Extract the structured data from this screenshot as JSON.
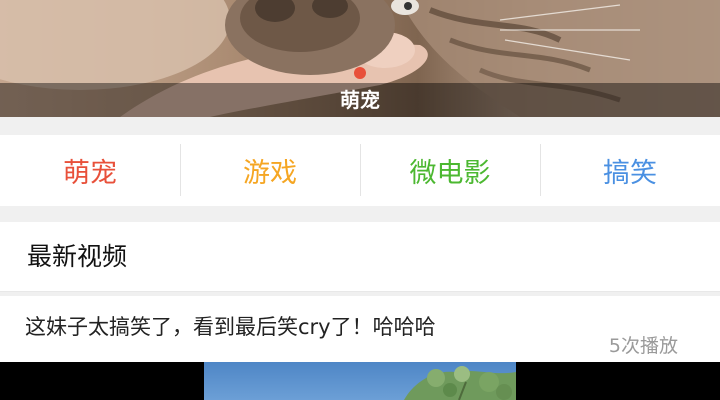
{
  "banner": {
    "caption": "萌宠",
    "image": "cat-paw-photo"
  },
  "categories": [
    {
      "label": "萌宠",
      "color": "#e8503a"
    },
    {
      "label": "游戏",
      "color": "#f5a623"
    },
    {
      "label": "微电影",
      "color": "#4cb831"
    },
    {
      "label": "搞笑",
      "color": "#4a90e2"
    }
  ],
  "latest": {
    "title": "最新视频",
    "videos": [
      {
        "title": "这妹子太搞笑了，看到最后笑cry了！哈哈哈",
        "plays": "5次播放"
      }
    ]
  }
}
